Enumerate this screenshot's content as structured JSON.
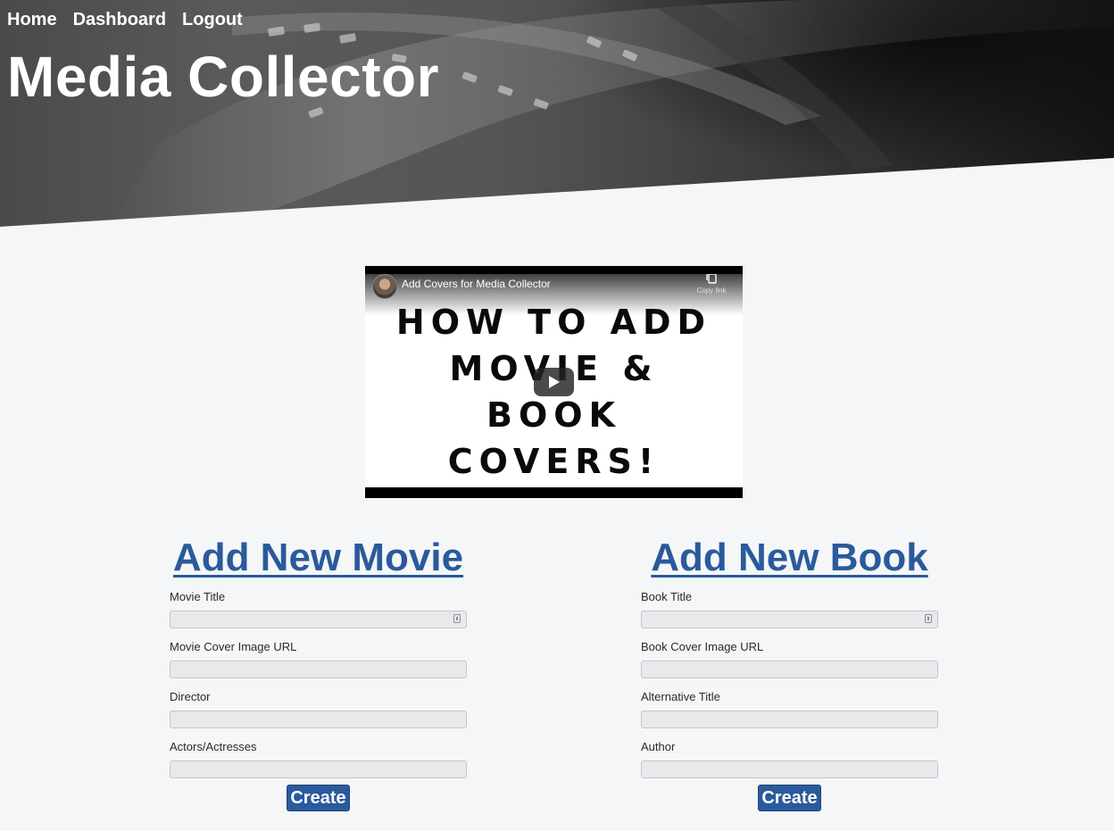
{
  "nav": {
    "items": [
      {
        "label": "Home"
      },
      {
        "label": "Dashboard"
      },
      {
        "label": "Logout"
      }
    ]
  },
  "site": {
    "title": "Media Collector"
  },
  "video": {
    "title": "Add Covers for Media Collector",
    "copy_link_label": "Copy link",
    "thumbnail_lines": [
      "HOW TO ADD",
      "MOVIE &",
      "BOOK",
      "COVERS!"
    ]
  },
  "movie_form": {
    "heading": "Add New Movie",
    "fields": [
      {
        "label": "Movie Title",
        "value": ""
      },
      {
        "label": "Movie Cover Image URL",
        "value": ""
      },
      {
        "label": "Director",
        "value": ""
      },
      {
        "label": "Actors/Actresses",
        "value": ""
      }
    ],
    "submit_label": "Create"
  },
  "book_form": {
    "heading": "Add New Book",
    "fields": [
      {
        "label": "Book Title",
        "value": ""
      },
      {
        "label": "Book Cover Image URL",
        "value": ""
      },
      {
        "label": "Alternative Title",
        "value": ""
      },
      {
        "label": "Author",
        "value": ""
      }
    ],
    "submit_label": "Create"
  },
  "colors": {
    "page_background": "#f4f6f8",
    "accent": "#2a5a9b",
    "input_background": "#e8e9eb"
  }
}
